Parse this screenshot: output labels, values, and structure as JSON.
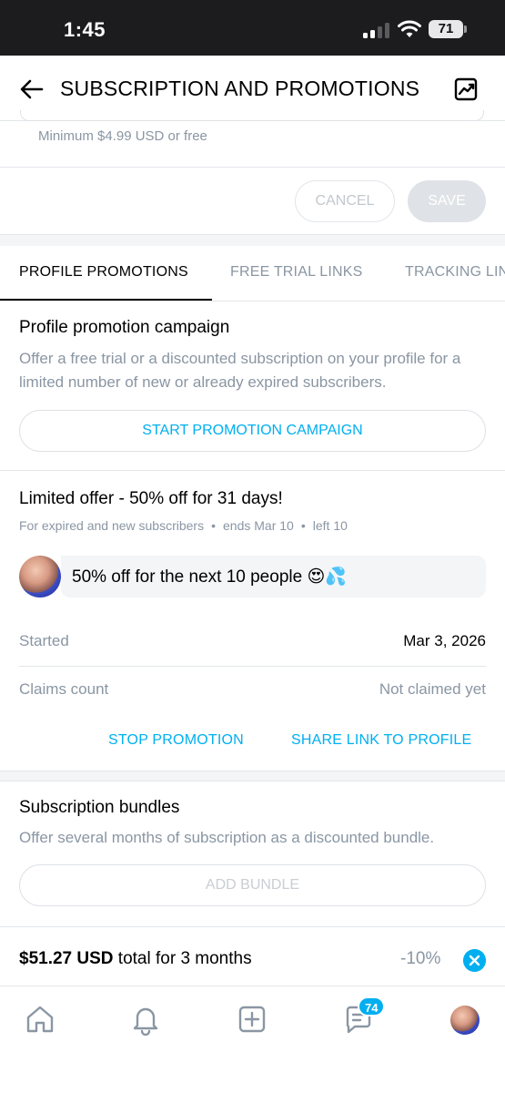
{
  "status_bar": {
    "time": "1:45",
    "battery": "71"
  },
  "header": {
    "title": "SUBSCRIPTION AND PROMOTIONS"
  },
  "price_form": {
    "hint": "Minimum $4.99 USD or free",
    "cancel_label": "CANCEL",
    "save_label": "SAVE"
  },
  "tabs": [
    {
      "label": "PROFILE PROMOTIONS",
      "active": true
    },
    {
      "label": "FREE TRIAL LINKS",
      "active": false
    },
    {
      "label": "TRACKING LINKS",
      "active": false
    }
  ],
  "campaign": {
    "title": "Profile promotion campaign",
    "description": "Offer a free trial or a discounted subscription on your profile for a limited number of new or already expired subscribers.",
    "button_label": "START PROMOTION CAMPAIGN"
  },
  "offer": {
    "title": "Limited offer - 50% off for 31 days!",
    "audience": "For expired and new subscribers",
    "ends": "ends Mar 10",
    "left": "left 10",
    "message": "50% off for the next 10 people 😍💦",
    "started_label": "Started",
    "started_value": "Mar 3, 2026",
    "claims_label": "Claims count",
    "claims_value": "Not claimed yet",
    "stop_label": "STOP PROMOTION",
    "share_label": "SHARE LINK TO PROFILE"
  },
  "bundles": {
    "title": "Subscription bundles",
    "description": "Offer several months of subscription as a discounted bundle.",
    "add_label": "ADD BUNDLE",
    "items": [
      {
        "price": "$51.27 USD",
        "suffix": "total for 3 months",
        "discount": "-10%"
      }
    ]
  },
  "bottom_nav": {
    "messages_badge": "74"
  },
  "colors": {
    "accent": "#00aff0",
    "muted": "#8a96a3",
    "divider": "#e3e6ea"
  }
}
